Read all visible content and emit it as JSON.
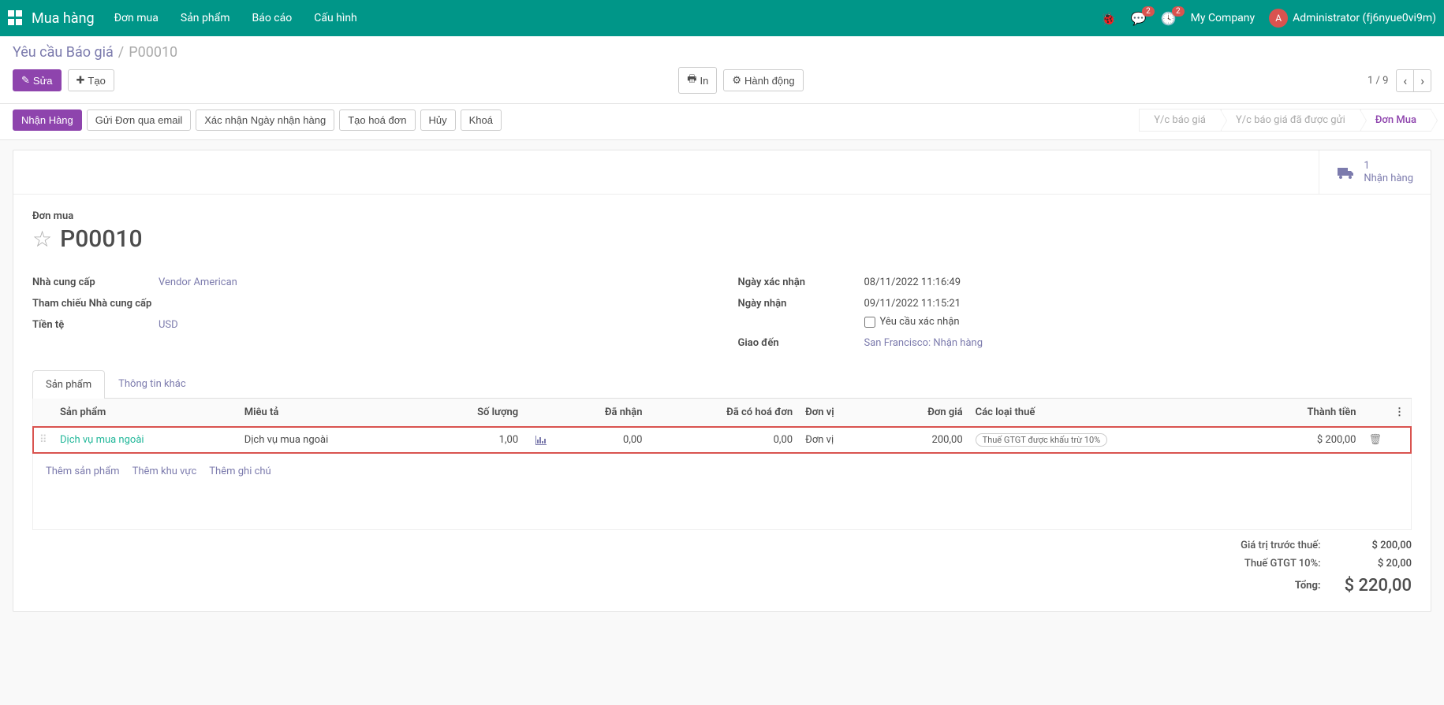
{
  "nav": {
    "brand": "Mua hàng",
    "menu": [
      "Đơn mua",
      "Sản phẩm",
      "Báo cáo",
      "Cấu hình"
    ],
    "msg_badge": "2",
    "activity_badge": "2",
    "company": "My Company",
    "user_initial": "A",
    "user_name": "Administrator (fj6nyue0vi9m)"
  },
  "breadcrumb": {
    "parent": "Yêu cầu Báo giá",
    "current": "P00010"
  },
  "buttons": {
    "edit": "Sửa",
    "create": "Tạo",
    "print": "In",
    "action": "Hành động"
  },
  "pager": {
    "text": "1 / 9"
  },
  "statusbar": {
    "buttons": [
      "Nhận Hàng",
      "Gửi Đơn qua email",
      "Xác nhận Ngày nhận hàng",
      "Tạo hoá đơn",
      "Hủy",
      "Khoá"
    ],
    "steps": [
      {
        "label": "Y/c báo giá",
        "active": false
      },
      {
        "label": "Y/c báo giá đã được gửi",
        "active": false
      },
      {
        "label": "Đơn Mua",
        "active": true
      }
    ]
  },
  "stat_button": {
    "count": "1",
    "label": "Nhận hàng"
  },
  "doc": {
    "type_label": "Đơn mua",
    "name": "P00010"
  },
  "fields_left": {
    "vendor_label": "Nhà cung cấp",
    "vendor_value": "Vendor American",
    "ref_label": "Tham chiếu Nhà cung cấp",
    "ref_value": "",
    "currency_label": "Tiền tệ",
    "currency_value": "USD"
  },
  "fields_right": {
    "confirm_date_label": "Ngày xác nhận",
    "confirm_date_value": "08/11/2022 11:16:49",
    "receipt_date_label": "Ngày nhận",
    "receipt_date_value": "09/11/2022 11:15:21",
    "ask_confirm_label": "Yêu cầu xác nhận",
    "deliver_to_label": "Giao đến",
    "deliver_to_value": "San Francisco: Nhận hàng"
  },
  "tabs": [
    "Sản phẩm",
    "Thông tin khác"
  ],
  "table": {
    "headers": {
      "product": "Sản phẩm",
      "desc": "Miêu tả",
      "qty": "Số lượng",
      "received": "Đã nhận",
      "billed": "Đã có hoá đơn",
      "uom": "Đơn vị",
      "price": "Đơn giá",
      "taxes": "Các loại thuế",
      "subtotal": "Thành tiền"
    },
    "row": {
      "product": "Dịch vụ mua ngoài",
      "desc": "Dịch vụ mua ngoài",
      "qty": "1,00",
      "received": "0,00",
      "billed": "0,00",
      "uom": "Đơn vị",
      "price": "200,00",
      "tax": "Thuế GTGT được khấu trừ 10%",
      "subtotal": "$ 200,00"
    },
    "add_product": "Thêm sản phẩm",
    "add_section": "Thêm khu vực",
    "add_note": "Thêm ghi chú"
  },
  "totals": {
    "untaxed_label": "Giá trị trước thuế:",
    "untaxed_value": "$ 200,00",
    "tax_label": "Thuế GTGT 10%:",
    "tax_value": "$ 20,00",
    "total_label": "Tổng:",
    "total_value": "$ 220,00"
  }
}
